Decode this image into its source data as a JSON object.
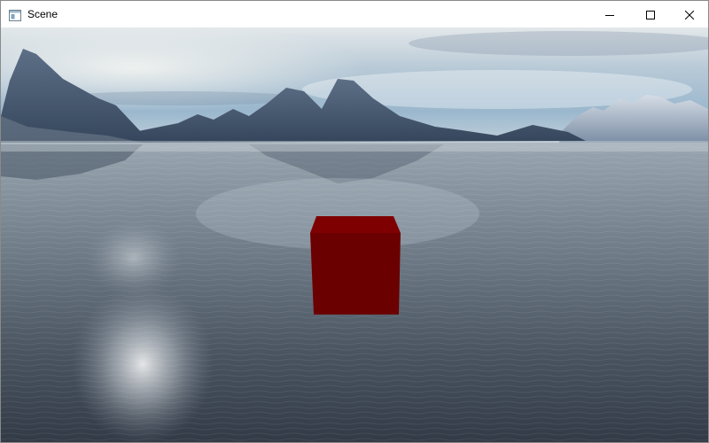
{
  "window": {
    "title": "Scene",
    "icon": "app-window-icon",
    "controls": [
      "minimize-icon",
      "maximize-icon",
      "close-icon"
    ]
  },
  "scene": {
    "sky_colors": [
      "#dfe6ea",
      "#a9c1d4",
      "#8fb0c9"
    ],
    "water_colors": [
      "#8e9aa6",
      "#5d6a78",
      "#39424f"
    ],
    "mountain_color": "#4a5c74",
    "cube_color": "#6b0000"
  }
}
